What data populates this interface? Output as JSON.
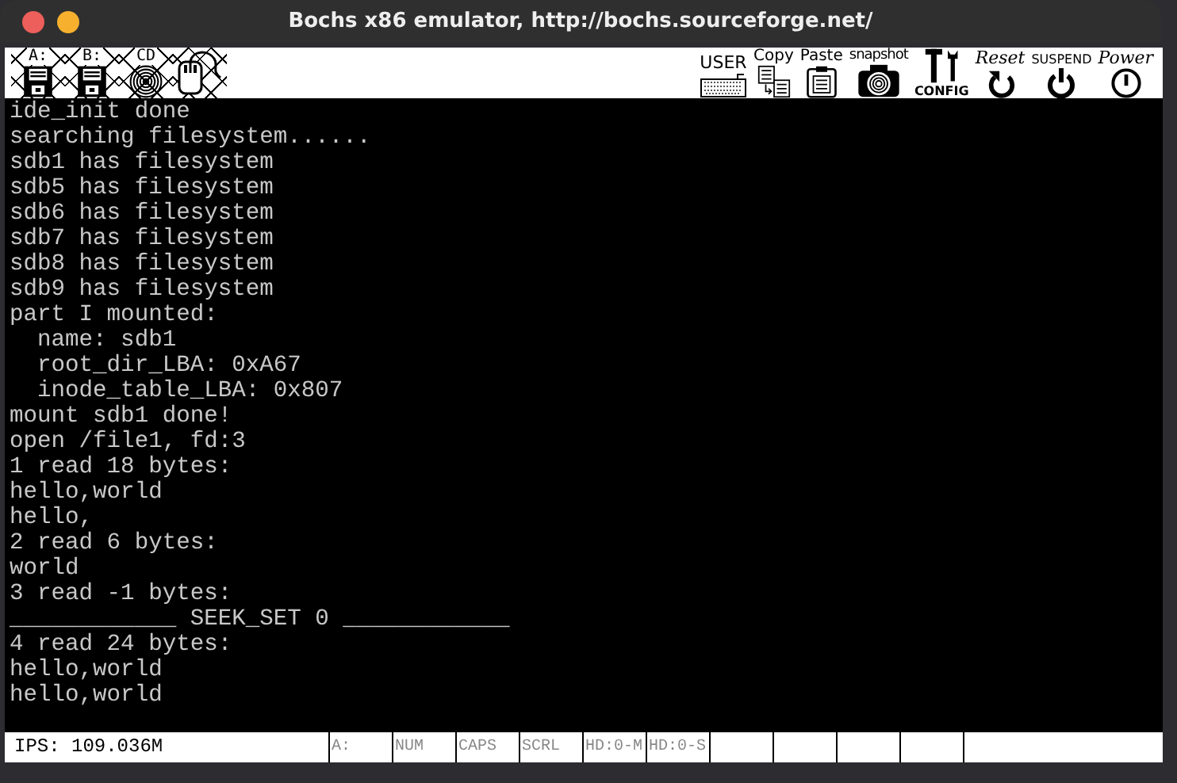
{
  "window": {
    "title": "Bochs x86 emulator, http://bochs.sourceforge.net/"
  },
  "toolbar": {
    "left_buttons": [
      {
        "kind": "floppy",
        "label": "A:"
      },
      {
        "kind": "floppy",
        "label": "B:"
      },
      {
        "kind": "cdrom",
        "label": "CD"
      },
      {
        "kind": "mouse"
      }
    ],
    "right_buttons": [
      {
        "kind": "keyboard",
        "label": "USER"
      },
      {
        "kind": "copy",
        "label": "Copy"
      },
      {
        "kind": "paste",
        "label": "Paste"
      },
      {
        "kind": "camera",
        "label": "snapshot"
      },
      {
        "kind": "config",
        "label": "CONFIG"
      },
      {
        "kind": "reset",
        "label": "Reset"
      },
      {
        "kind": "suspend",
        "label": "SUSPEND"
      },
      {
        "kind": "power",
        "label": "Power"
      }
    ]
  },
  "console": {
    "lines": [
      "ide_init done",
      "searching filesystem......",
      "sdb1 has filesystem",
      "sdb5 has filesystem",
      "sdb6 has filesystem",
      "sdb7 has filesystem",
      "sdb8 has filesystem",
      "sdb9 has filesystem",
      "part I mounted:",
      "  name: sdb1",
      "  root_dir_LBA: 0xA67",
      "  inode_table_LBA: 0x807",
      "mount sdb1 done!",
      "open /file1, fd:3",
      "1 read 18 bytes:",
      "hello,world",
      "hello,",
      "2 read 6 bytes:",
      "world",
      "3 read -1 bytes:",
      "____________ SEEK_SET 0 ____________",
      "4 read 24 bytes:",
      "hello,world",
      "hello,world"
    ]
  },
  "status_bar": {
    "ips": "IPS: 109.036M",
    "indicators": [
      {
        "label": "A:",
        "active": false
      },
      {
        "label": "NUM",
        "active": false
      },
      {
        "label": "CAPS",
        "active": false
      },
      {
        "label": "SCRL",
        "active": false
      },
      {
        "label": "HD:0-M",
        "active": false
      },
      {
        "label": "HD:0-S",
        "active": false
      }
    ]
  }
}
